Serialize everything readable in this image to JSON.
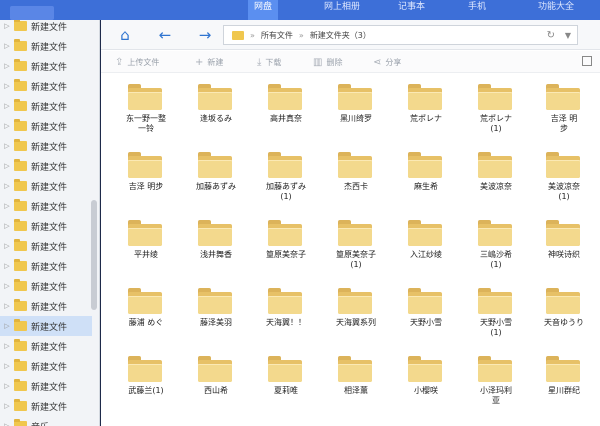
{
  "topbar": {
    "tabs": [
      {
        "label": "网盘",
        "active": true
      },
      {
        "label": "网上相册",
        "active": false
      },
      {
        "label": "记事本",
        "active": false
      },
      {
        "label": "手机",
        "active": false
      },
      {
        "label": "功能大全",
        "active": false
      }
    ]
  },
  "sidebar": {
    "items": [
      {
        "label": "新建文件"
      },
      {
        "label": "新建文件"
      },
      {
        "label": "新建文件"
      },
      {
        "label": "新建文件"
      },
      {
        "label": "新建文件"
      },
      {
        "label": "新建文件"
      },
      {
        "label": "新建文件"
      },
      {
        "label": "新建文件"
      },
      {
        "label": "新建文件"
      },
      {
        "label": "新建文件"
      },
      {
        "label": "新建文件"
      },
      {
        "label": "新建文件"
      },
      {
        "label": "新建文件"
      },
      {
        "label": "新建文件"
      },
      {
        "label": "新建文件"
      },
      {
        "label": "新建文件",
        "selected": true
      },
      {
        "label": "新建文件"
      },
      {
        "label": "新建文件"
      },
      {
        "label": "新建文件"
      },
      {
        "label": "新建文件"
      },
      {
        "label": "音乐"
      }
    ]
  },
  "navbar": {
    "home_icon": "home-icon",
    "back_icon": "arrow-left-icon",
    "forward_icon": "arrow-right-icon",
    "breadcrumb": [
      "所有文件",
      "新建文件夹（3）"
    ],
    "separator": "»",
    "refresh_glyph": "↻",
    "dropdown_glyph": "▼"
  },
  "toolbar": {
    "upload": "上传文件",
    "new_folder": "新建",
    "download": "下载",
    "delete": "删除",
    "share": "分享"
  },
  "folders": [
    {
      "name": "东一野一整\n一铃"
    },
    {
      "name": "逢坂るみ"
    },
    {
      "name": "高井真奈"
    },
    {
      "name": "黑川绮罗"
    },
    {
      "name": "荒ポレナ"
    },
    {
      "name": "荒ポレナ\n(1)"
    },
    {
      "name": "吉泽 明\n步"
    },
    {
      "name": "吉泽 明步"
    },
    {
      "name": "加藤あずみ"
    },
    {
      "name": "加藤あずみ\n(1)"
    },
    {
      "name": "杰西卡"
    },
    {
      "name": "麻生希"
    },
    {
      "name": "美波凉奈"
    },
    {
      "name": "美波凉奈\n(1)"
    },
    {
      "name": "平井绫"
    },
    {
      "name": "浅井舞香"
    },
    {
      "name": "篁原美奈子"
    },
    {
      "name": "篁原美奈子\n(1)"
    },
    {
      "name": "入江纱绫"
    },
    {
      "name": "三嶋沙希\n(1)"
    },
    {
      "name": "神咲诗织"
    },
    {
      "name": "藤浦 めぐ"
    },
    {
      "name": "藤泽美羽"
    },
    {
      "name": "天海翼！！"
    },
    {
      "name": "天海翼系列"
    },
    {
      "name": "天野小雪"
    },
    {
      "name": "天野小雪\n(1)"
    },
    {
      "name": "天音ゆうり"
    },
    {
      "name": "武藤兰(1)"
    },
    {
      "name": "西山希"
    },
    {
      "name": "夏莉唯"
    },
    {
      "name": "相泽薰"
    },
    {
      "name": "小樱咲"
    },
    {
      "name": "小泽玛利\n亚"
    },
    {
      "name": "星川群纪"
    }
  ]
}
